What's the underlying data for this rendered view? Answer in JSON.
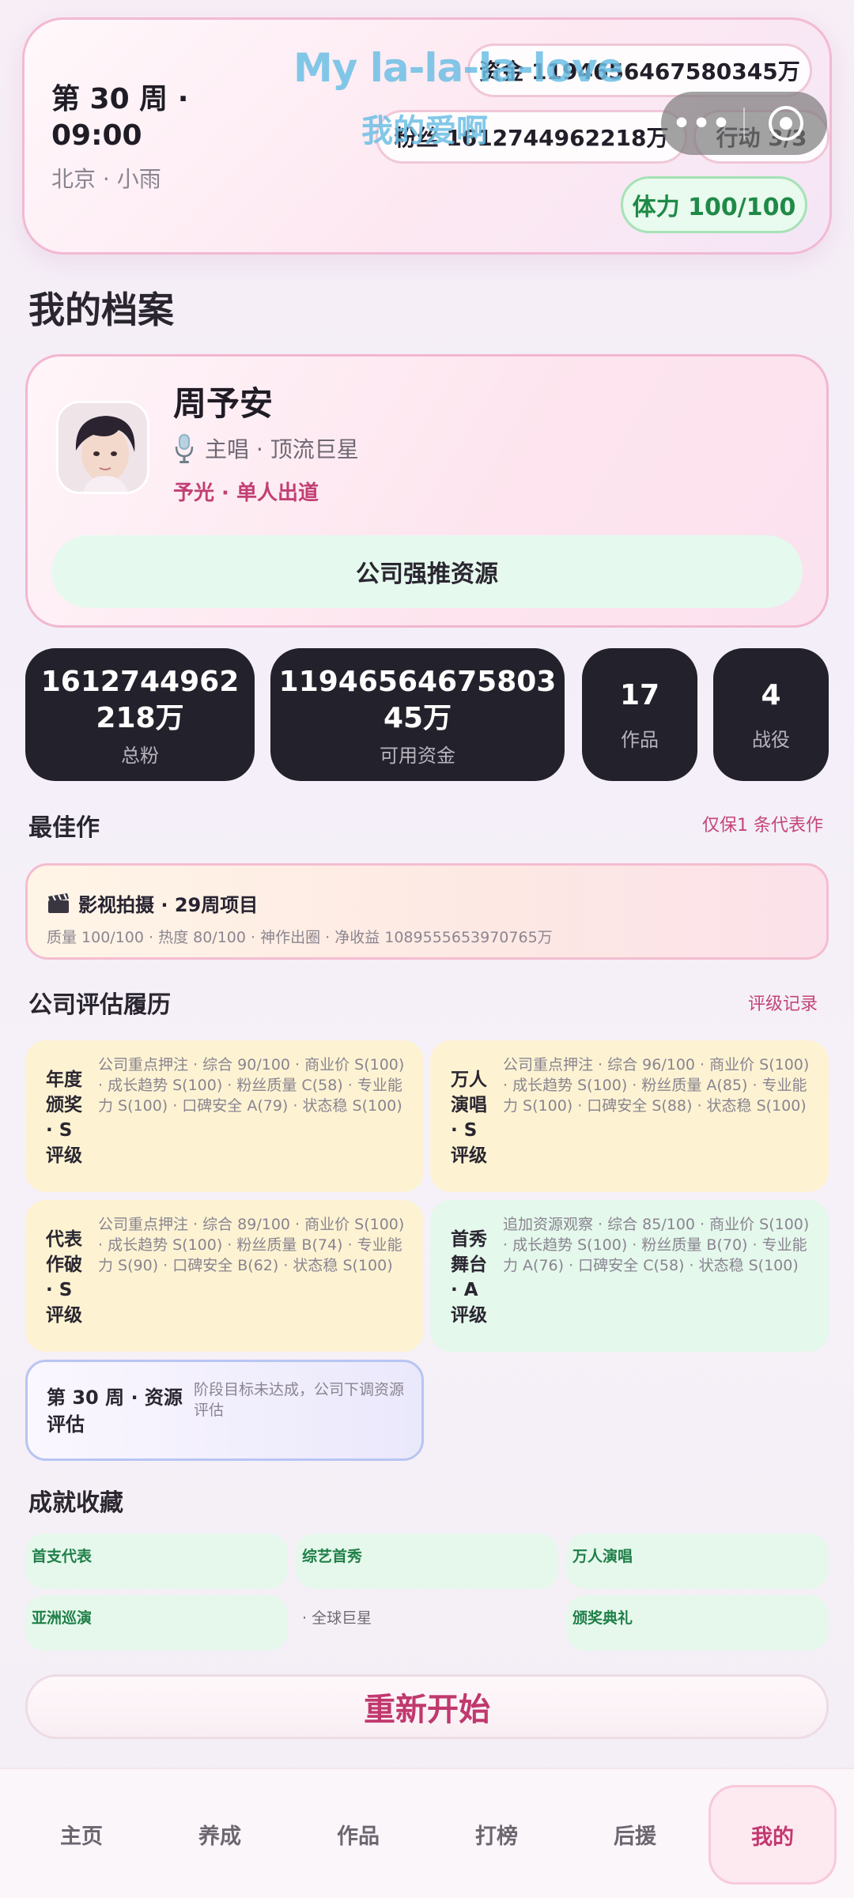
{
  "header": {
    "week_time": "第 30 周 · 09:00",
    "location_weather": "北京 · 小雨",
    "funds_pill": "资金 1194656467580345万",
    "fans_pill": "粉丝 1612744962218万",
    "action_pill": "行动 3/3",
    "stamina_pill": "体力 100/100",
    "overlay_line1": "My la-la-la-love",
    "overlay_line2": "我的爱啊",
    "capsule_dots": "•••"
  },
  "profile": {
    "section_title": "我的档案",
    "name": "周予安",
    "role": "主唱 · 顶流巨星",
    "group": "予光 · 单人出道",
    "push_button": "公司强推资源"
  },
  "stats": [
    {
      "value": "1612744962218万",
      "label": "总粉"
    },
    {
      "value": "1194656467580345万",
      "label": "可用资金"
    },
    {
      "value": "17",
      "label": "作品"
    },
    {
      "value": "4",
      "label": "战役"
    }
  ],
  "best_work": {
    "section_title": "最佳作",
    "link": "仅保1 条代表作",
    "title": "影视拍摄 · 29周项目",
    "detail": "质量 100/100 · 热度 80/100 · 神作出圈 · 净收益 1089555653970765万"
  },
  "evaluation": {
    "section_title": "公司评估履历",
    "link": "评级记录",
    "cards": [
      {
        "title": "年度颁奖 · S 评级",
        "detail": "公司重点押注 · 综合 90/100 · 商业价 S(100) · 成长趋势 S(100) · 粉丝质量 C(58) · 专业能力 S(100) · 口碑安全 A(79) · 状态稳 S(100)"
      },
      {
        "title": "万人演唱 · S 评级",
        "detail": "公司重点押注 · 综合 96/100 · 商业价 S(100) · 成长趋势 S(100) · 粉丝质量 A(85) · 专业能力 S(100) · 口碑安全 S(88) · 状态稳 S(100)"
      },
      {
        "title": "代表作破 · S 评级",
        "detail": "公司重点押注 · 综合 89/100 · 商业价 S(100) · 成长趋势 S(100) · 粉丝质量 B(74) · 专业能力 S(90) · 口碑安全 B(62) · 状态稳 S(100)"
      },
      {
        "title": "首秀舞台 · A 评级",
        "detail": "追加资源观察 · 综合 85/100 · 商业价 S(100) · 成长趋势 S(100) · 粉丝质量 B(70) · 专业能力 A(76) · 口碑安全 C(58) · 状态稳 S(100)"
      }
    ],
    "stage": {
      "title": "第 30 周 · 资源评估",
      "detail": "阶段目标未达成，公司下调资源评估"
    }
  },
  "achievements": {
    "section_title": "成就收藏",
    "items": [
      "首支代表",
      "综艺首秀",
      "万人演唱",
      "亚洲巡演",
      "· 全球巨星",
      "颁奖典礼"
    ]
  },
  "restart_button": "重新开始",
  "nav": {
    "items": [
      "主页",
      "养成",
      "作品",
      "打榜",
      "后援",
      "我的"
    ],
    "active": "我的"
  },
  "colors": {
    "accent_pink": "#c3386f",
    "stat_dark": "#23212b",
    "success_green": "#1f8a47"
  }
}
